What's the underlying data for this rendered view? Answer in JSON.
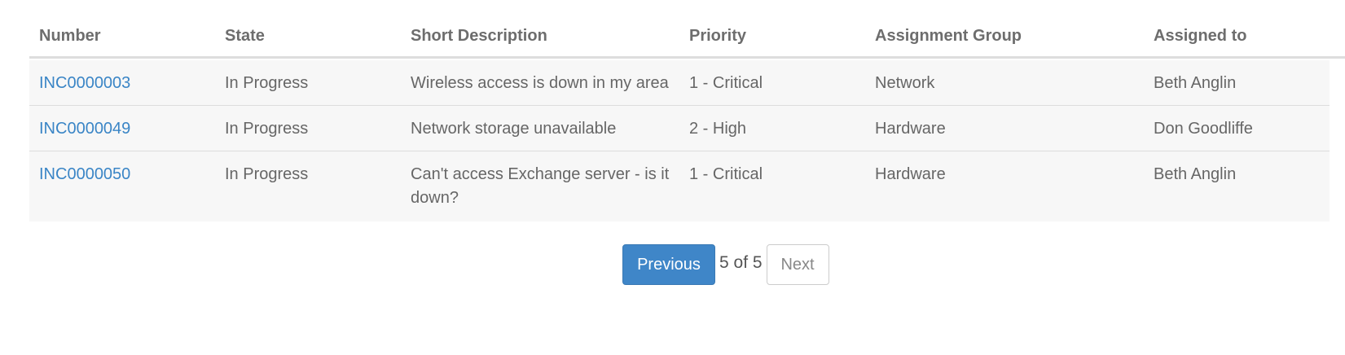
{
  "table": {
    "headers": {
      "number": "Number",
      "state": "State",
      "short_description": "Short Description",
      "priority": "Priority",
      "assignment_group": "Assignment Group",
      "assigned_to": "Assigned to"
    },
    "rows": [
      {
        "number": "INC0000003",
        "state": "In Progress",
        "short_description": "Wireless access is down in my area",
        "priority": "1 - Critical",
        "assignment_group": "Network",
        "assigned_to": "Beth Anglin"
      },
      {
        "number": "INC0000049",
        "state": "In Progress",
        "short_description": "Network storage unavailable",
        "priority": "2 - High",
        "assignment_group": "Hardware",
        "assigned_to": "Don Goodliffe"
      },
      {
        "number": "INC0000050",
        "state": "In Progress",
        "short_description": "Can't access Exchange server - is it down?",
        "priority": "1 - Critical",
        "assignment_group": "Hardware",
        "assigned_to": "Beth Anglin"
      }
    ]
  },
  "pagination": {
    "previous_label": "Previous",
    "page_count": "5 of 5",
    "next_label": "Next"
  },
  "colors": {
    "link": "#3a85c6",
    "primary_button": "#3f86c8",
    "row_background": "#f7f7f7"
  }
}
